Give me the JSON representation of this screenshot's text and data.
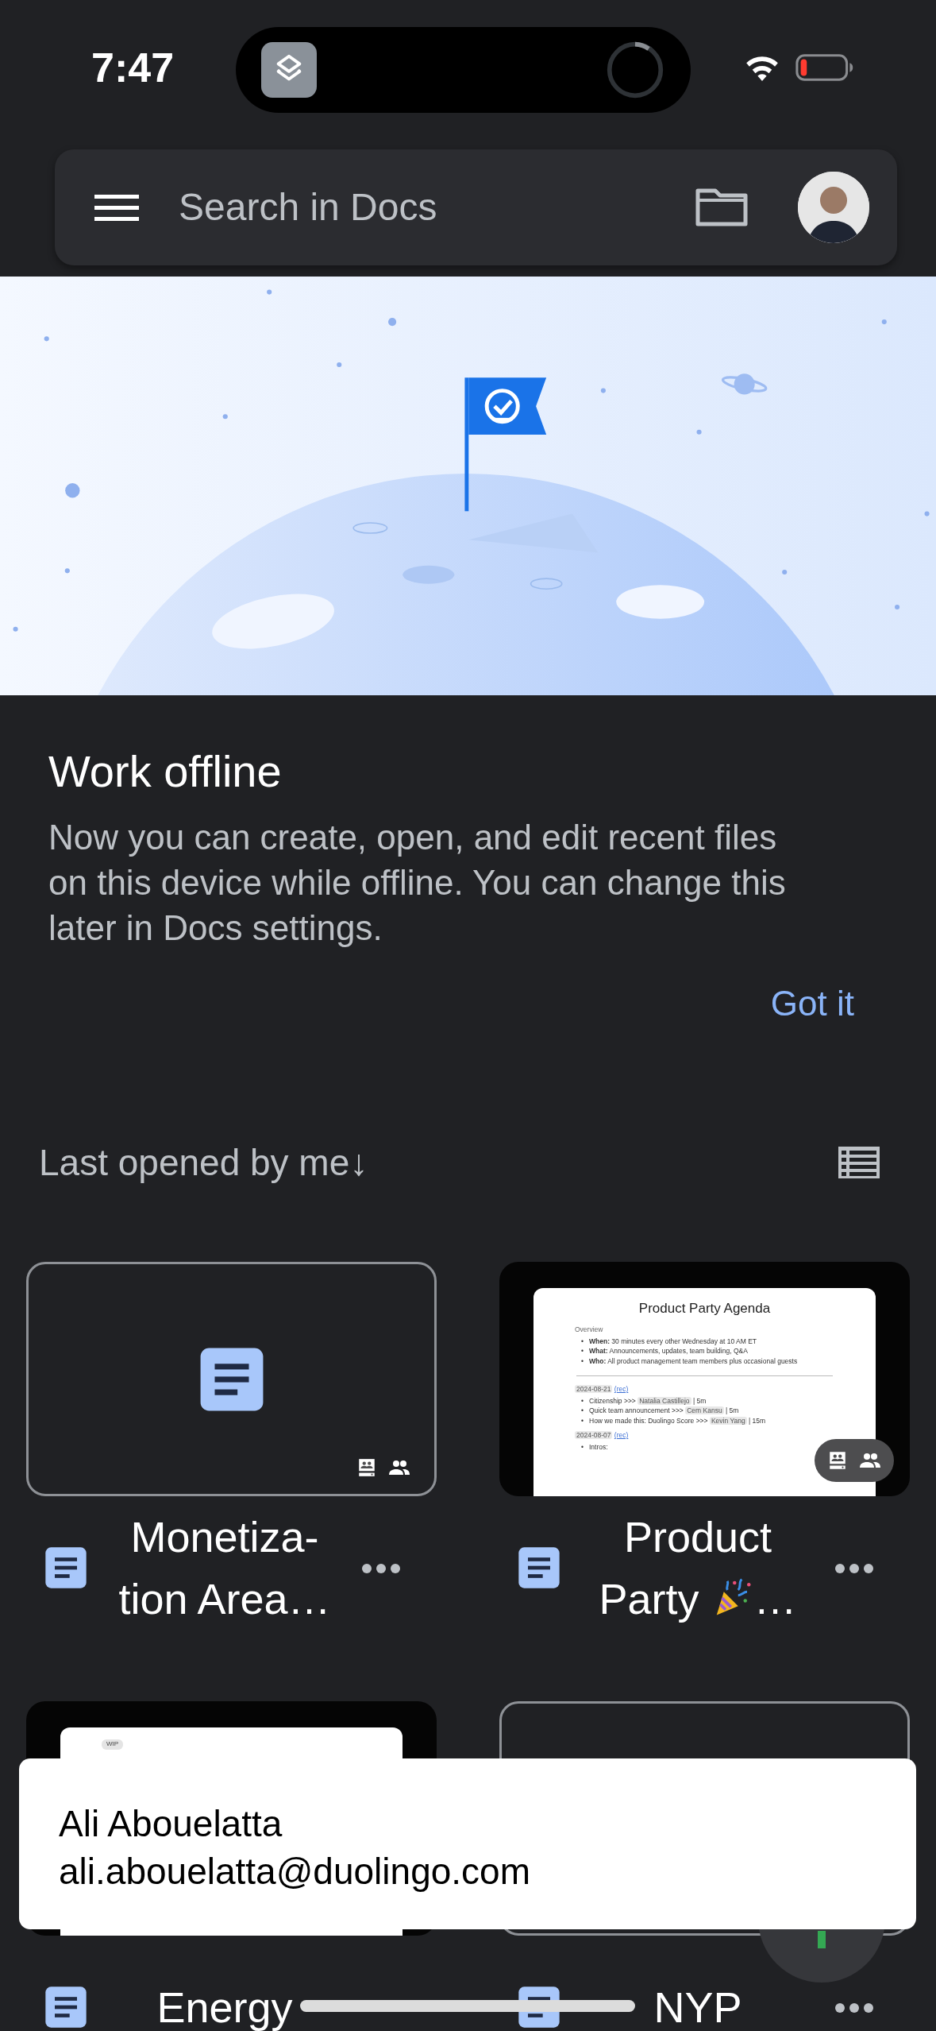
{
  "status_bar": {
    "time": "7:47"
  },
  "search": {
    "placeholder": "Search in Docs"
  },
  "offline_card": {
    "title": "Work offline",
    "body_lines": [
      "Now you can create, open, and edit recent files",
      "on this device while offline. You can change this",
      "later in Docs settings."
    ],
    "action": "Got it"
  },
  "sort": {
    "label": "Last opened by me",
    "arrow": "↓"
  },
  "files": [
    {
      "kind": "blank",
      "center_icon": true,
      "title_lines": [
        {
          "text": "Monetiza-"
        },
        {
          "text": "tion Area…"
        }
      ],
      "offline": true,
      "shared": true,
      "more": true
    },
    {
      "kind": "preview",
      "title_lines": [
        {
          "text": "Product"
        },
        {
          "text": "Party",
          "has_icon": true,
          "tail": "…"
        }
      ],
      "offline": true,
      "shared": true,
      "more": true,
      "preview": {
        "marker": "•",
        "title": "Product Party Agenda",
        "heading": "Overview",
        "bullets": [
          "**When:** 30 minutes every other Wednesday at 10 AM ET",
          "**What:** Announcements, updates, team building, Q&A",
          "**Who:** All product management team members plus occasional guests"
        ],
        "sessions": [
          {
            "date": "2024-08-21",
            "link": "(rec)",
            "items": [
              {
                "text": "Citizenship >>>",
                "person": "Natalia Castillejo",
                "suffix": "| 5m"
              },
              {
                "text": "Quick team announcement >>>",
                "person": "Cem Kansu",
                "suffix": "| 5m"
              },
              {
                "text": "How we made this: Duolingo Score >>>",
                "person": "Kevin Yang",
                "suffix": "| 15m"
              }
            ]
          },
          {
            "date": "2024-08-07",
            "link": "(rec)",
            "items": [
              {
                "text": "Intros:"
              }
            ]
          }
        ]
      }
    },
    {
      "kind": "preview",
      "title_lines": [
        {
          "text": "Energy"
        }
      ],
      "offline": false,
      "shared": false,
      "more": false,
      "preview": {
        "chip": "WIP"
      }
    },
    {
      "kind": "blank",
      "title_lines": [
        {
          "text": "NYP"
        }
      ],
      "continues": true,
      "offline": false,
      "shared": false,
      "more": true
    }
  ],
  "toast": {
    "name": "Ali Abouelatta",
    "email": "ali.abouelatta@duolingo.com"
  }
}
